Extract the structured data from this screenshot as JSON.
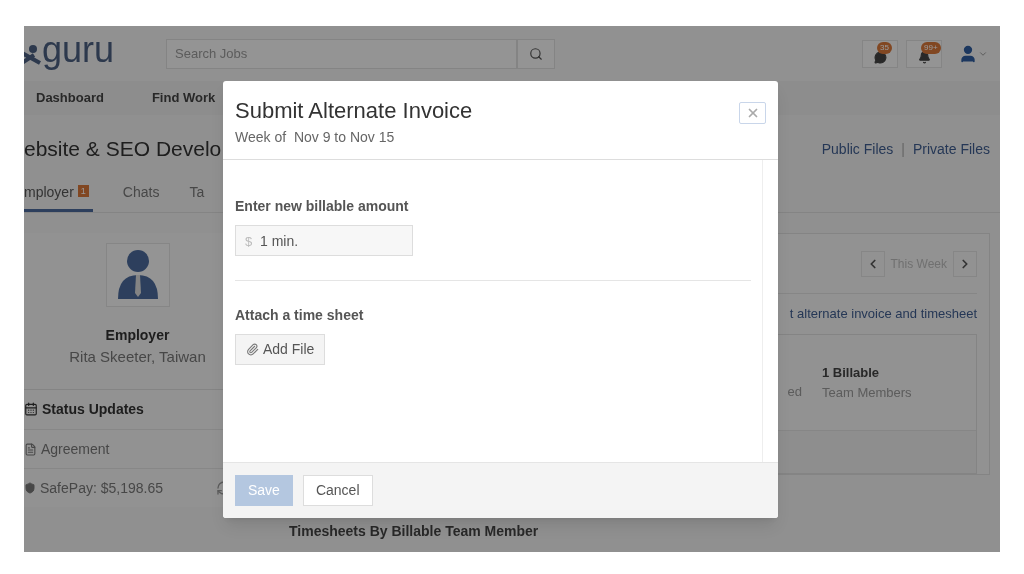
{
  "header": {
    "logo": "guru",
    "search": {
      "placeholder": "Search Jobs"
    },
    "notifications": [
      {
        "kind": "messages",
        "count": "35"
      },
      {
        "kind": "alerts",
        "count": "99+"
      }
    ]
  },
  "nav": [
    "Dashboard",
    "Find Work"
  ],
  "project": {
    "title": "ebsite & SEO Develo",
    "links": [
      "Public Files",
      "Private Files"
    ],
    "separator": "|"
  },
  "tabs": [
    {
      "label": "mployer",
      "badge": "1",
      "selected": true
    },
    {
      "label": "Chats",
      "selected": false
    },
    {
      "label": "Ta",
      "selected": false
    }
  ],
  "employer_card": {
    "role": "Employer",
    "name": "Rita Skeeter, Taiwan"
  },
  "sidebar": {
    "heading": "Status Updates",
    "items": [
      {
        "kind": "document",
        "label": "Agreement"
      },
      {
        "kind": "safepay",
        "label": "SafePay: $5,198.65"
      }
    ]
  },
  "week_nav": {
    "label": "This Week"
  },
  "notice": "t alternate invoice and timesheet",
  "summary": {
    "fragment": "ed",
    "billable": "1 Billable",
    "members": "Team Members"
  },
  "timesheets_heading": "Timesheets By Billable Team Member",
  "modal": {
    "title": "Submit Alternate Invoice",
    "subtitle": "Week of  Nov 9 to Nov 15",
    "amount_label": "Enter new billable amount",
    "currency": "$",
    "amount_placeholder": "1 min.",
    "attach_label": "Attach a time sheet",
    "add_file": "Add File",
    "buttons": [
      {
        "kind": "primary",
        "label": "Save",
        "disabled": true
      },
      {
        "kind": "secondary",
        "label": "Cancel",
        "disabled": false
      }
    ]
  }
}
